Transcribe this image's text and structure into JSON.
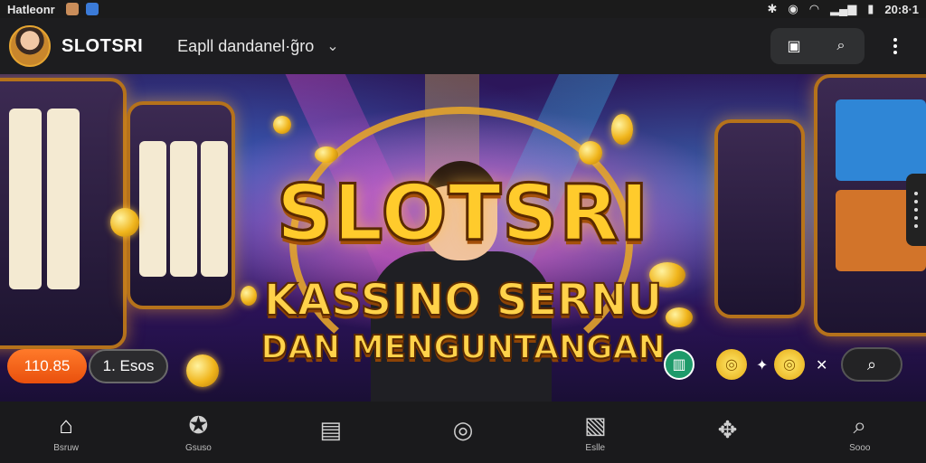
{
  "status_bar": {
    "app_name": "Hatleonr",
    "time": "20:8·1",
    "icons": [
      "bluetooth-icon",
      "alarm-icon",
      "wifi-icon",
      "signal-icon",
      "battery-icon"
    ]
  },
  "header": {
    "brand": "SLOTSRI",
    "game_select": "Eapll dandanel·g̃ro",
    "actions": [
      "gallery-icon",
      "search-icon"
    ],
    "menu_icon": "more-vert-icon"
  },
  "hero": {
    "title": "SLOTSRI",
    "subtitle_line1": "KASSINO SERNU",
    "subtitle_line2": "DAN MENGUNTANGAN",
    "balance": "110.85",
    "bet": "1. Esos",
    "colors": {
      "accent": "#ffcb2c",
      "orange": "#f0661a",
      "purple": "#3a1677"
    }
  },
  "bottom_nav": {
    "items": [
      {
        "label": "Bsruw",
        "icon": "home-icon",
        "active": true
      },
      {
        "label": "Gsuso",
        "icon": "star-icon",
        "active": false
      },
      {
        "label": "",
        "icon": "chat-icon",
        "active": false
      },
      {
        "label": "",
        "icon": "target-icon",
        "active": false
      },
      {
        "label": "Eslle",
        "icon": "chart-icon",
        "active": false
      },
      {
        "label": "",
        "icon": "shuffle-icon",
        "active": false
      },
      {
        "label": "Sooo",
        "icon": "search-icon",
        "active": false
      }
    ]
  }
}
